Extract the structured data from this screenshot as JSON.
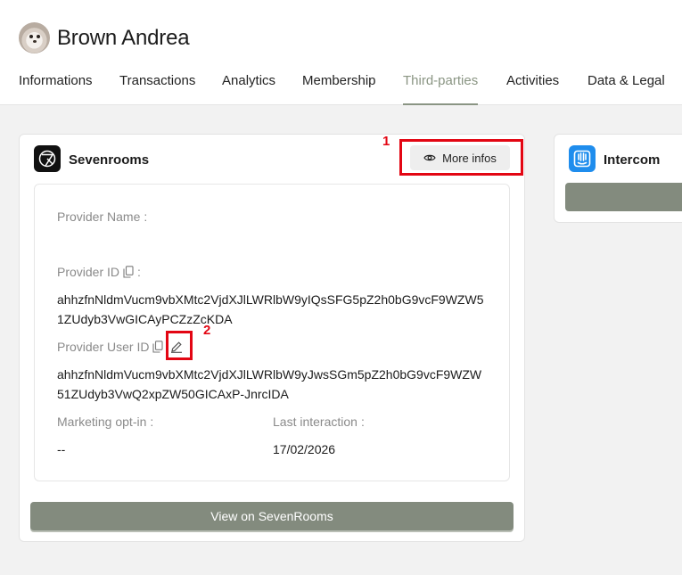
{
  "user": {
    "name": "Brown Andrea"
  },
  "tabs": [
    {
      "label": "Informations"
    },
    {
      "label": "Transactions"
    },
    {
      "label": "Analytics"
    },
    {
      "label": "Membership"
    },
    {
      "label": "Third-parties",
      "active": true
    },
    {
      "label": "Activities"
    },
    {
      "label": "Data & Legal"
    }
  ],
  "sevenrooms": {
    "title": "Sevenrooms",
    "logo_icon": "sevenrooms-logo-icon",
    "more_infos_label": "More infos",
    "more_infos_icon": "eye-icon",
    "provider_name_label": "Provider Name",
    "provider_name_value": "",
    "provider_id_label": "Provider ID",
    "provider_id_value": "ahhzfnNldmVucm9vbXMtc2VjdXJlLWRlbW9yIQsSFG5pZ2h0bG9vcF9WZW51ZUdyb3VwGICAyPCZzZcKDA",
    "provider_user_id_label": "Provider User ID",
    "provider_user_id_value": "ahhzfnNldmVucm9vbXMtc2VjdXJlLWRlbW9yJwsSGm5pZ2h0bG9vcF9WZW51ZUdyb3VwQ2xpZW50GICAxP-JnrcIDA",
    "marketing_label": "Marketing opt-in",
    "marketing_value": "--",
    "last_interaction_label": "Last interaction",
    "last_interaction_value": "17/02/2026",
    "view_button_label": "View on SevenRooms"
  },
  "intercom": {
    "title": "Intercom",
    "logo_icon": "intercom-logo-icon"
  },
  "annotations": {
    "first": "1",
    "second": "2"
  },
  "colors": {
    "accent": "#838b7e",
    "annotation": "#e30613",
    "active_tab": "#8a9583"
  }
}
